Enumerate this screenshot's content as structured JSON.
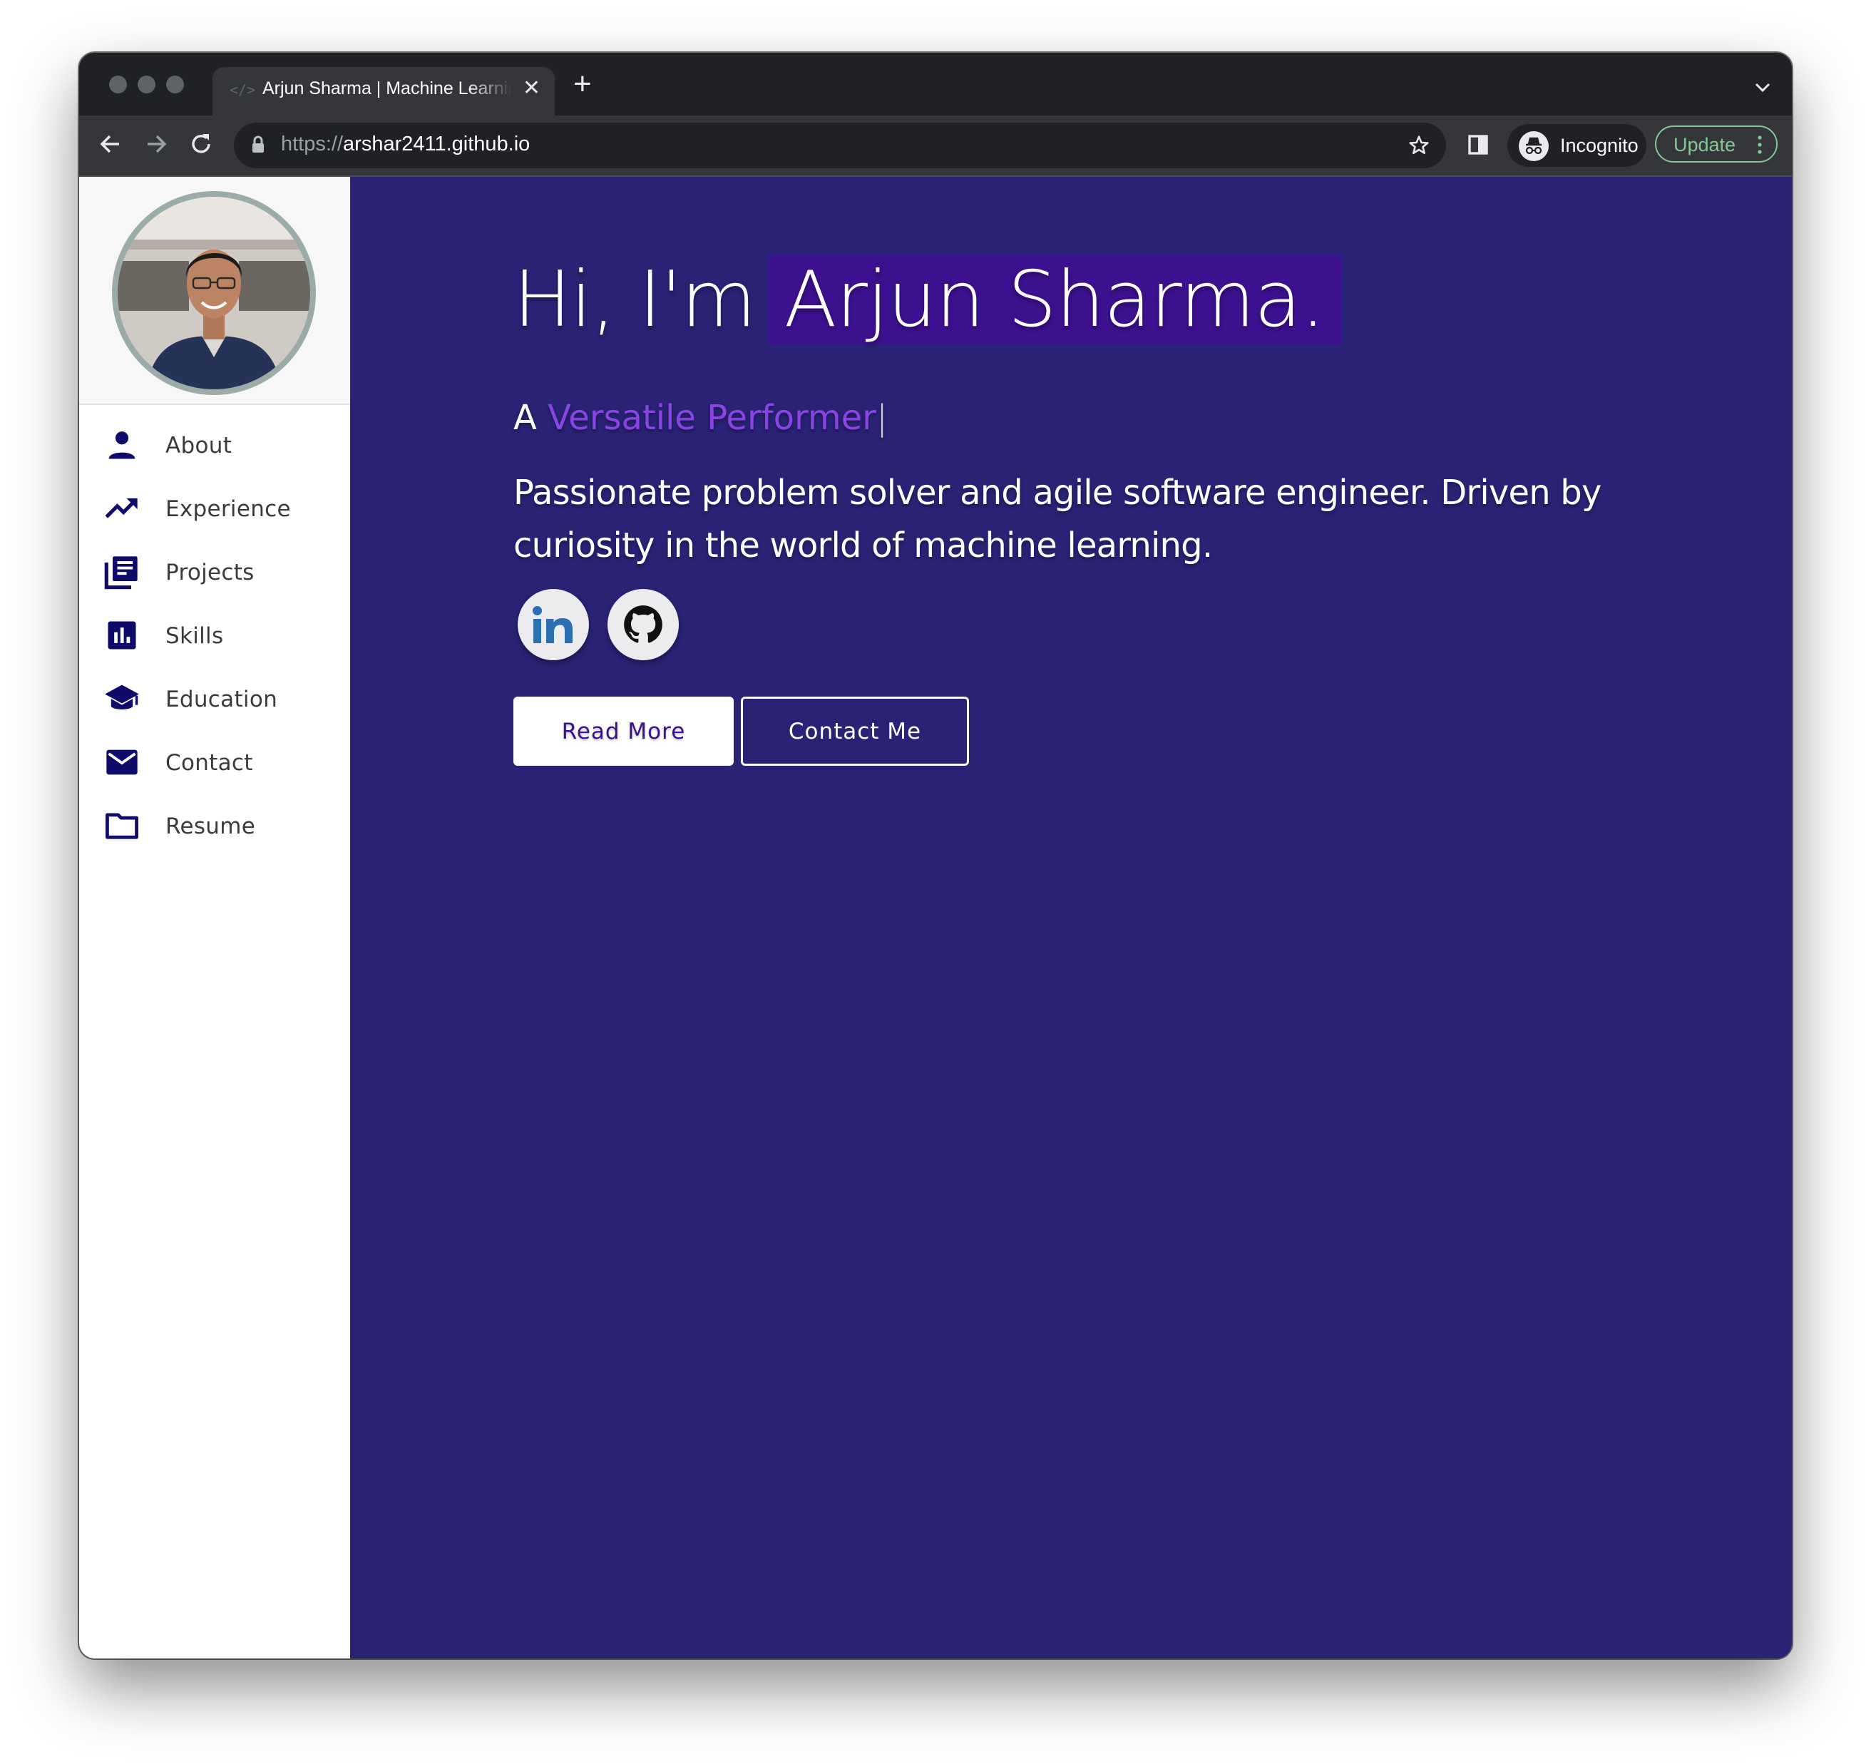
{
  "browser": {
    "tab_title": "Arjun Sharma | Machine Learning",
    "tab_favicon": "</>",
    "url_scheme": "https://",
    "url_host": "arshar2411.github.io",
    "incognito_label": "Incognito",
    "update_label": "Update"
  },
  "sidebar": {
    "avatar_alt": "profile-photo",
    "items": [
      {
        "label": "About",
        "icon": "person-icon"
      },
      {
        "label": "Experience",
        "icon": "trending-up-icon"
      },
      {
        "label": "Projects",
        "icon": "library-books-icon"
      },
      {
        "label": "Skills",
        "icon": "bar-chart-icon"
      },
      {
        "label": "Education",
        "icon": "graduation-cap-icon"
      },
      {
        "label": "Contact",
        "icon": "mail-icon"
      },
      {
        "label": "Resume",
        "icon": "folder-icon"
      }
    ]
  },
  "hero": {
    "greeting": "Hi, I'm",
    "name": "Arjun Sharma.",
    "subtitle_prefix": "A",
    "role": "Versatile Performer",
    "caret": "|",
    "bio": "Passionate problem solver and agile software engineer. Driven by curiosity in the world of machine learning.",
    "read_more": "Read More",
    "contact_me": "Contact Me"
  },
  "colors": {
    "main_bg": "#2a2275",
    "name_highlight": "#3c118f",
    "role": "#8a44e6",
    "nav_icon": "#0e0b6b",
    "chrome_dark": "#202124",
    "update_green": "#81c995"
  }
}
